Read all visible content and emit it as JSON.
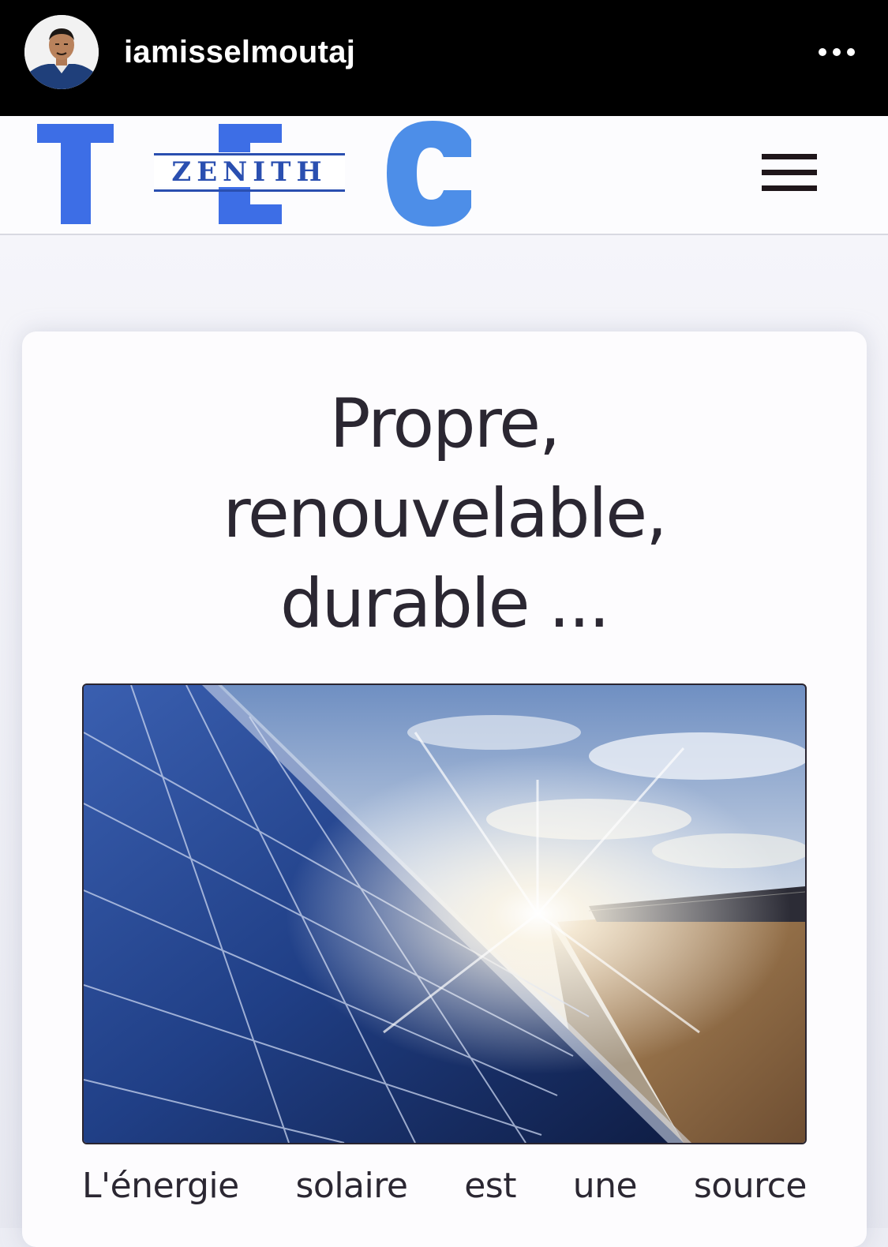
{
  "post_header": {
    "username": "iamisselmoutaj",
    "avatar_icon": "profile-photo",
    "more_icon": "more-dots-icon"
  },
  "site_header": {
    "logo_letters": [
      "T",
      "E",
      "C"
    ],
    "logo_word": "ZENITH",
    "logo_color": "#3d6ee6",
    "logo_c_color": "#4d8ee8",
    "menu_icon": "hamburger-menu-icon"
  },
  "hero": {
    "headline_lines": [
      "Propre,",
      "renouvelable,",
      "durable ..."
    ],
    "image_icon": "solar-panels-photo",
    "body_words": [
      "L'énergie",
      "solaire",
      "est",
      "une",
      "source"
    ]
  },
  "colors": {
    "header_bg": "#000000",
    "text_dark": "#2b2732",
    "card_bg": "#fdfcfe",
    "page_bg": "#ecedf4"
  }
}
